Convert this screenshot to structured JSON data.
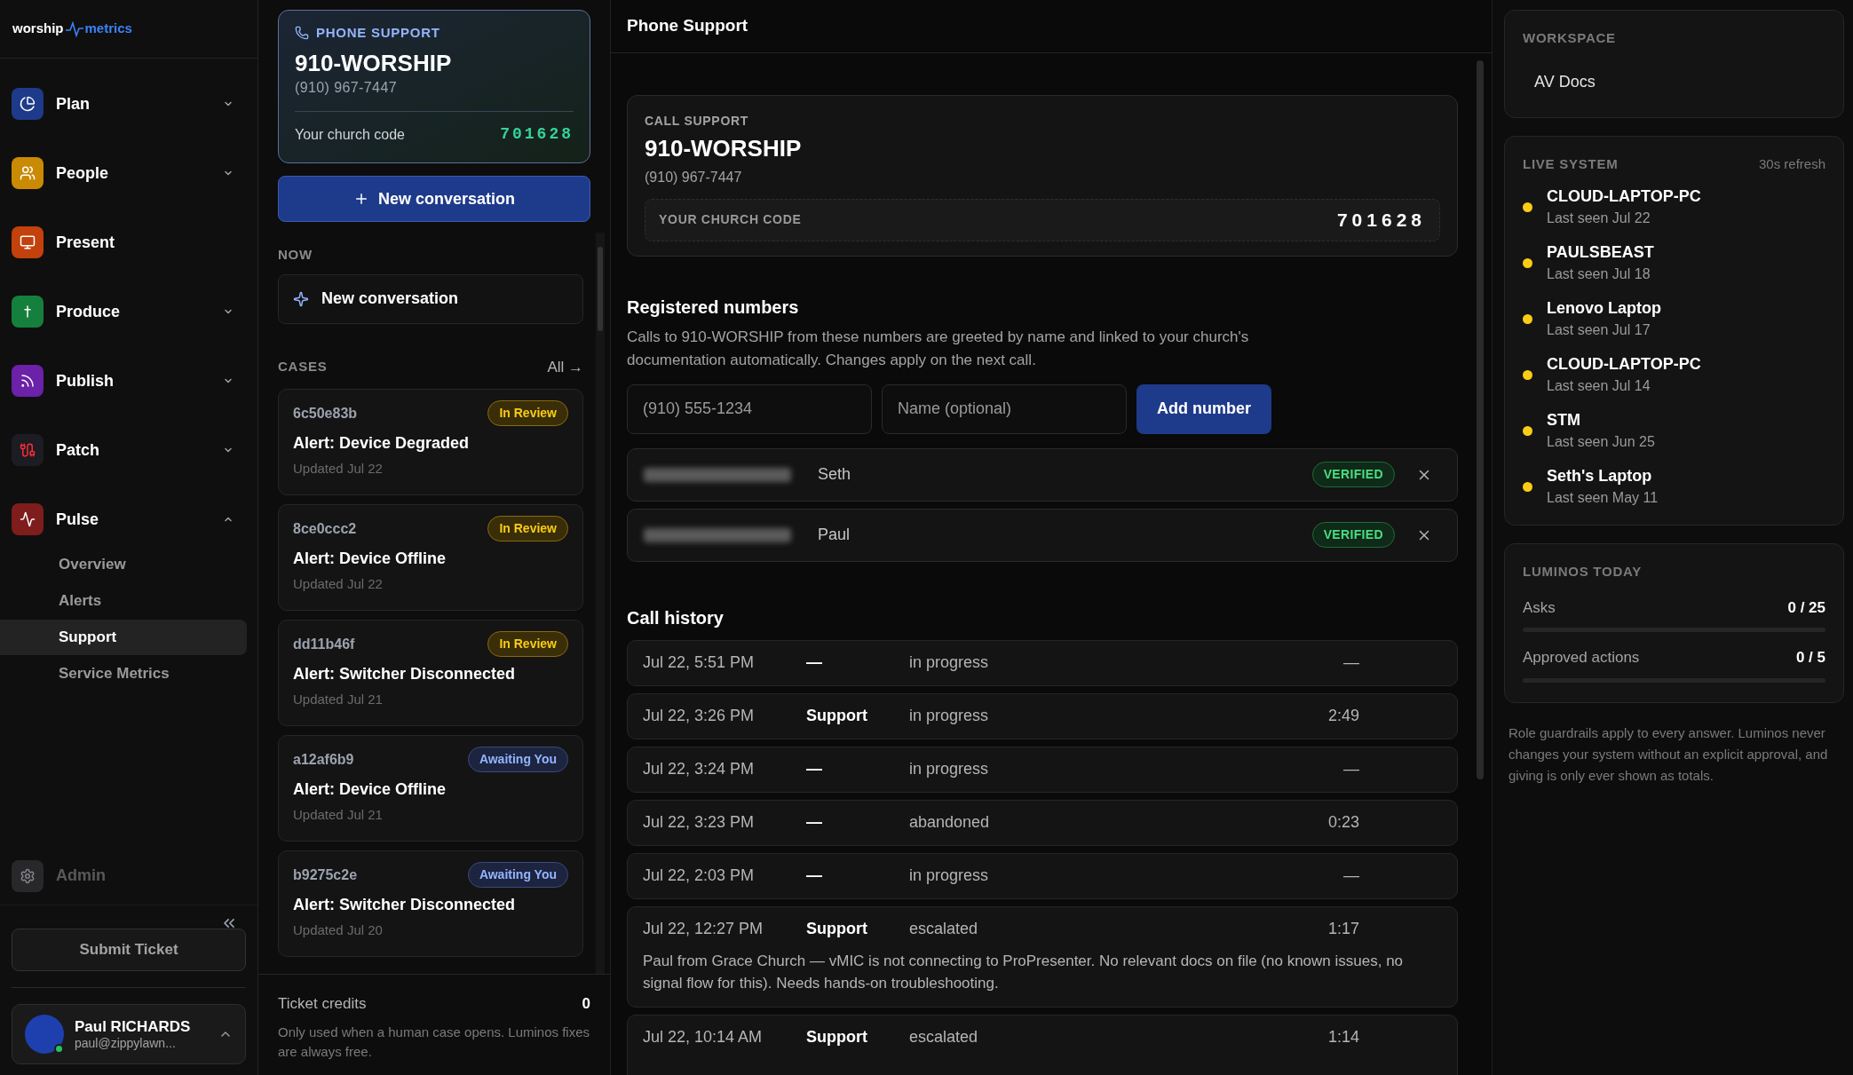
{
  "logo": {
    "left": "worship",
    "right": "metrics"
  },
  "nav": [
    {
      "label": "Plan",
      "kind": "group",
      "expanded": false,
      "color": "#1e3a8a"
    },
    {
      "label": "People",
      "kind": "group",
      "expanded": false,
      "color": "#ca8a04"
    },
    {
      "label": "Present",
      "kind": "link",
      "color": "#c2410c"
    },
    {
      "label": "Produce",
      "kind": "group",
      "expanded": false,
      "color": "#15803d"
    },
    {
      "label": "Publish",
      "kind": "group",
      "expanded": false,
      "color": "#6b21a8"
    },
    {
      "label": "Patch",
      "kind": "group",
      "expanded": false,
      "color": "#1c1c22"
    },
    {
      "label": "Pulse",
      "kind": "group",
      "expanded": true,
      "color": "#7f1d1d",
      "children": [
        {
          "label": "Overview",
          "selected": false
        },
        {
          "label": "Alerts",
          "selected": false
        },
        {
          "label": "Support",
          "selected": true
        },
        {
          "label": "Service Metrics",
          "selected": false
        }
      ]
    }
  ],
  "admin": {
    "label": "Admin",
    "disabled": true
  },
  "submit_ticket": "Submit Ticket",
  "user": {
    "name": "Paul RICHARDS",
    "email": "paul@zippylawn..."
  },
  "phone_card": {
    "label": "PHONE SUPPORT",
    "title": "910-WORSHIP",
    "number": "(910) 967-7447",
    "code_label": "Your church code",
    "code": "701628"
  },
  "new_conversation_button": "New conversation",
  "now": {
    "label": "NOW",
    "item": "New conversation"
  },
  "cases": {
    "label": "CASES",
    "all_link": "All →",
    "items": [
      {
        "id": "6c50e83b",
        "status": "In Review",
        "kind": "review",
        "title": "Alert: Device Degraded",
        "updated": "Updated Jul 22"
      },
      {
        "id": "8ce0ccc2",
        "status": "In Review",
        "kind": "review",
        "title": "Alert: Device Offline",
        "updated": "Updated Jul 22"
      },
      {
        "id": "dd11b46f",
        "status": "In Review",
        "kind": "review",
        "title": "Alert: Switcher Disconnected",
        "updated": "Updated Jul 21"
      },
      {
        "id": "a12af6b9",
        "status": "Awaiting You",
        "kind": "awaiting",
        "title": "Alert: Device Offline",
        "updated": "Updated Jul 21"
      },
      {
        "id": "b9275c2e",
        "status": "Awaiting You",
        "kind": "awaiting",
        "title": "Alert: Switcher Disconnected",
        "updated": "Updated Jul 20"
      }
    ]
  },
  "ticket_credits": {
    "label": "Ticket credits",
    "value": "0",
    "note": "Only used when a human case opens. Luminos fixes are always free."
  },
  "main": {
    "title": "Phone Support",
    "call_support": {
      "label": "CALL SUPPORT",
      "title": "910-WORSHIP",
      "number": "(910) 967-7447",
      "code_label": "YOUR CHURCH CODE",
      "code": "701628"
    },
    "registered": {
      "title": "Registered numbers",
      "description": "Calls to 910-WORSHIP from these numbers are greeted by name and linked to your church's documentation automatically. Changes apply on the next call.",
      "number_placeholder": "(910) 555-1234",
      "name_placeholder": "Name (optional)",
      "add_button": "Add number",
      "numbers": [
        {
          "name": "Seth",
          "badge": "VERIFIED"
        },
        {
          "name": "Paul",
          "badge": "VERIFIED"
        }
      ]
    },
    "call_history": {
      "title": "Call history",
      "rows": [
        {
          "time": "Jul 22, 5:51 PM",
          "agent": "—",
          "status": "in progress",
          "duration": "—"
        },
        {
          "time": "Jul 22, 3:26 PM",
          "agent": "Support",
          "status": "in progress",
          "duration": "2:49"
        },
        {
          "time": "Jul 22, 3:24 PM",
          "agent": "—",
          "status": "in progress",
          "duration": "—"
        },
        {
          "time": "Jul 22, 3:23 PM",
          "agent": "—",
          "status": "abandoned",
          "duration": "0:23"
        },
        {
          "time": "Jul 22, 2:03 PM",
          "agent": "—",
          "status": "in progress",
          "duration": "—"
        },
        {
          "time": "Jul 22, 12:27 PM",
          "agent": "Support",
          "status": "escalated",
          "duration": "1:17",
          "summary": "Paul from Grace Church — vMIC is not connecting to ProPresenter. No relevant docs on file (no known issues, no signal flow for this). Needs hands-on troubleshooting."
        },
        {
          "time": "Jul 22, 10:14 AM",
          "agent": "Support",
          "status": "escalated",
          "duration": "1:14"
        }
      ]
    }
  },
  "workspace": {
    "label": "WORKSPACE",
    "value": "AV Docs"
  },
  "live_system": {
    "label": "LIVE SYSTEM",
    "refresh": "30s refresh",
    "devices": [
      {
        "name": "CLOUD-LAPTOP-PC",
        "seen": "Last seen Jul 22",
        "color": "#facc15"
      },
      {
        "name": "PAULSBEAST",
        "seen": "Last seen Jul 18",
        "color": "#facc15"
      },
      {
        "name": "Lenovo Laptop",
        "seen": "Last seen Jul 17",
        "color": "#facc15"
      },
      {
        "name": "CLOUD-LAPTOP-PC",
        "seen": "Last seen Jul 14",
        "color": "#facc15"
      },
      {
        "name": "STM",
        "seen": "Last seen Jun 25",
        "color": "#facc15"
      },
      {
        "name": "Seth's Laptop",
        "seen": "Last seen May 11",
        "color": "#facc15"
      }
    ]
  },
  "luminos": {
    "label": "LUMINOS TODAY",
    "meters": [
      {
        "name": "Asks",
        "reading": "0 / 25",
        "level": 0
      },
      {
        "name": "Approved actions",
        "reading": "0 / 5",
        "level": 0
      }
    ]
  },
  "footnote": "Role guardrails apply to every answer. Luminos never changes your system without an explicit approval, and giving is only ever shown as totals."
}
